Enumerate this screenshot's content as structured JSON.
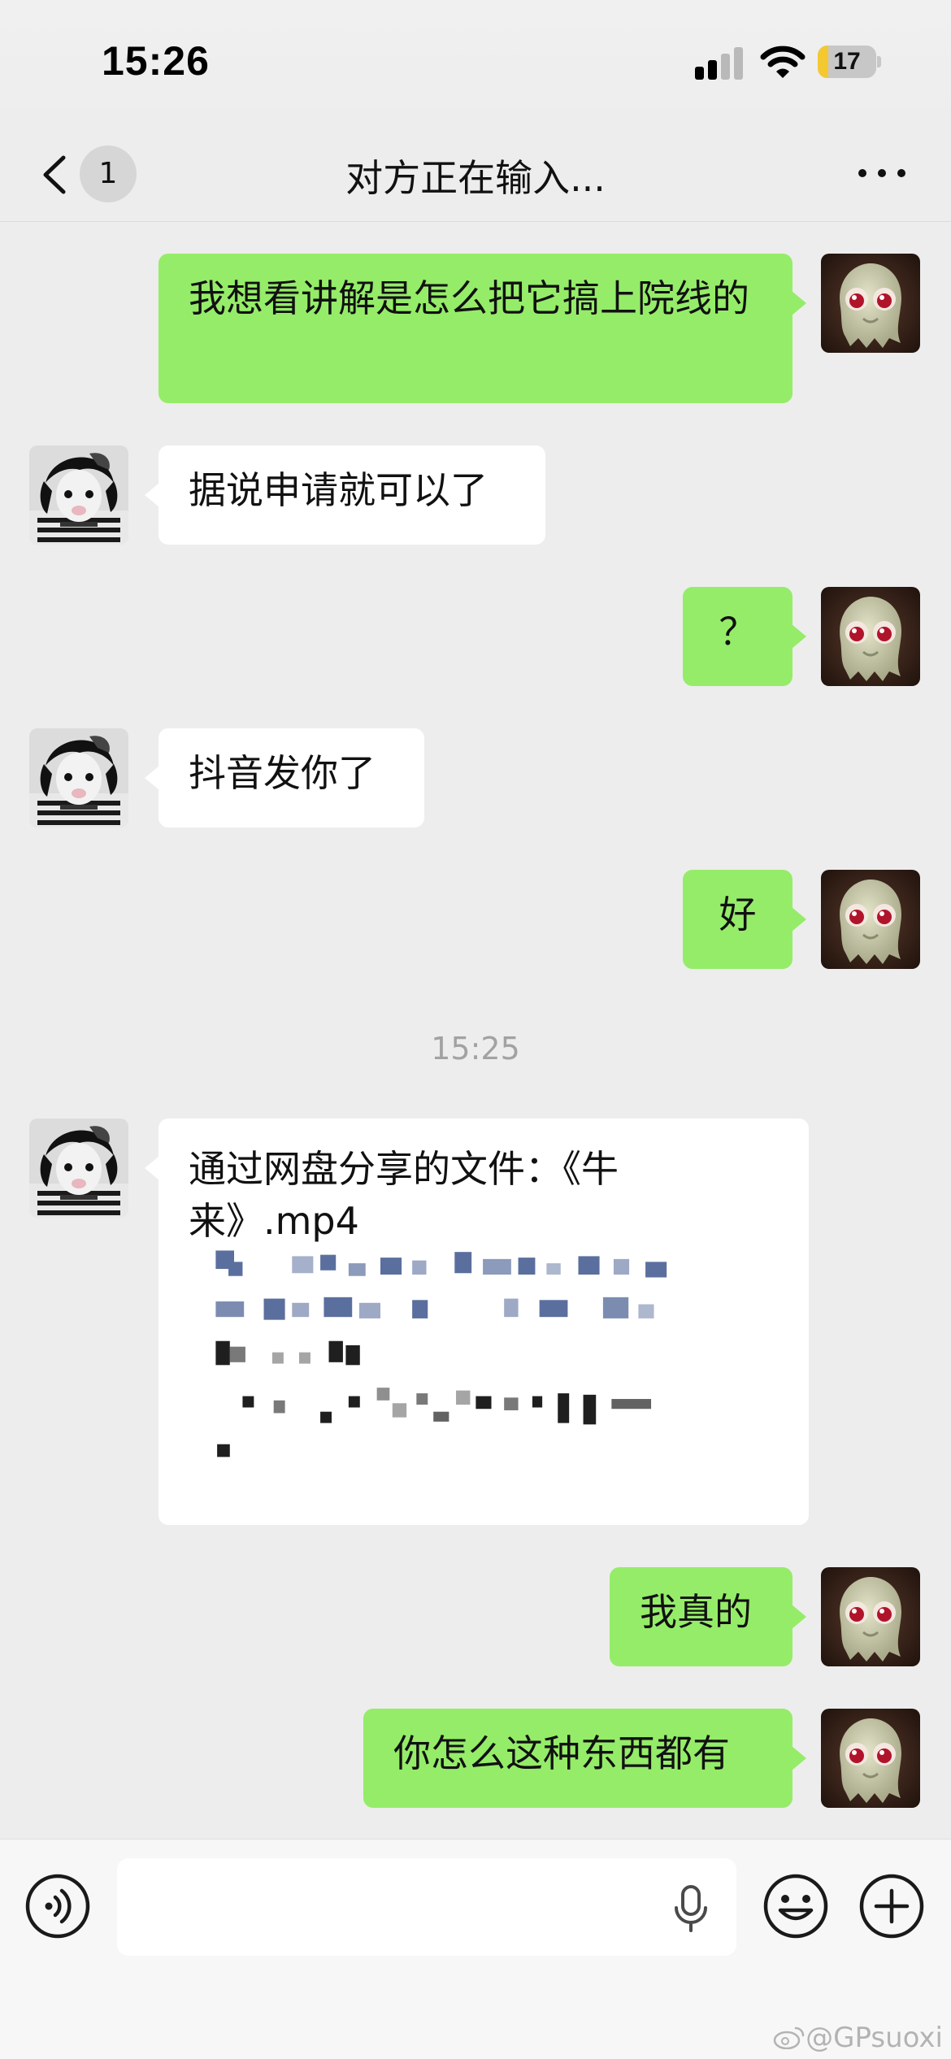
{
  "status_bar": {
    "time": "15:26",
    "battery_level": "17",
    "icons": [
      "cellular-signal-icon",
      "wifi-icon",
      "battery-icon"
    ]
  },
  "nav": {
    "unread_count": "1",
    "title": "对方正在输入...",
    "icons": [
      "back-chevron-icon",
      "more-dots-icon"
    ]
  },
  "messages": [
    {
      "side": "out",
      "text": "我想看讲解是怎么把它搞上院线的"
    },
    {
      "side": "in",
      "text": "据说申请就可以了"
    },
    {
      "side": "out",
      "text": "？"
    },
    {
      "side": "in",
      "text": "抖音发你了"
    },
    {
      "side": "out",
      "text": "好"
    },
    {
      "side": "in",
      "text": "通过网盘分享的文件：《牛来》.mp4"
    },
    {
      "side": "out",
      "text": "我真的"
    },
    {
      "side": "out",
      "text": "你怎么这种东西都有"
    }
  ],
  "timestamp": "15:25",
  "input_bar": {
    "icons": [
      "voice-mode-icon",
      "microphone-icon",
      "emoji-icon",
      "plus-icon"
    ]
  },
  "watermark": "@GPsuoxi",
  "colors": {
    "chat_background": "#ededed",
    "outgoing_bubble": "#95ec69",
    "incoming_bubble": "#ffffff",
    "battery_low": "#f4c830",
    "timestamp_text": "#a2a2a2"
  }
}
